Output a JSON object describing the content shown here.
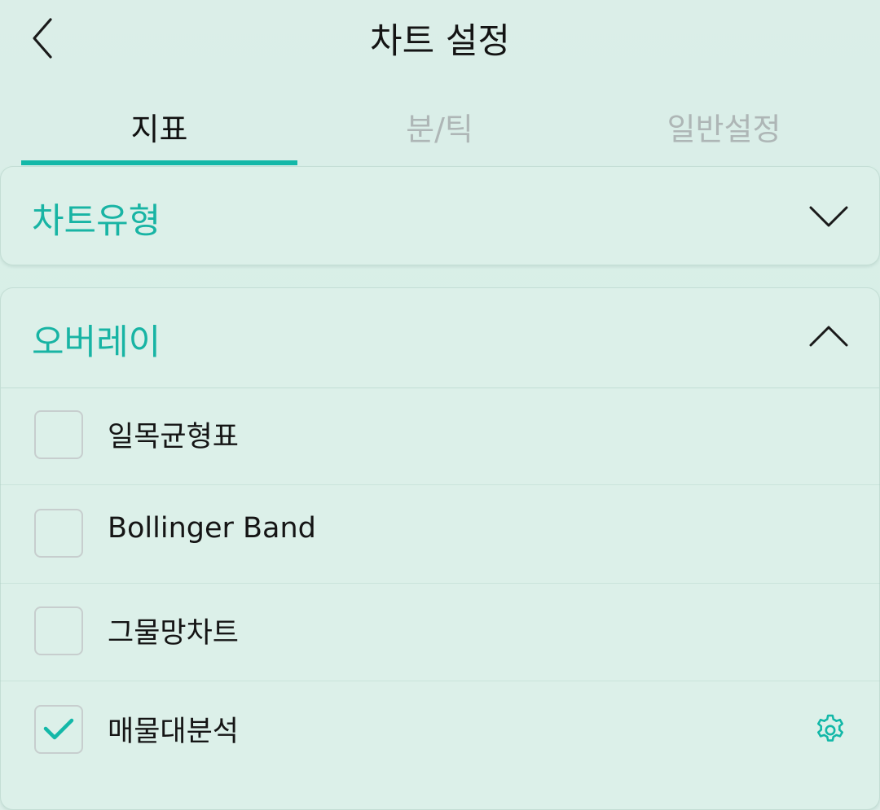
{
  "header": {
    "title": "차트 설정",
    "back_icon": "chevron-left-icon"
  },
  "tabs": [
    {
      "label": "지표",
      "active": true
    },
    {
      "label": "분/틱",
      "active": false
    },
    {
      "label": "일반설정",
      "active": false
    }
  ],
  "sections": {
    "chart_type": {
      "title": "차트유형",
      "expanded": false,
      "icon": "chevron-down-icon"
    },
    "overlay": {
      "title": "오버레이",
      "expanded": true,
      "icon": "chevron-up-icon"
    }
  },
  "overlay_items": [
    {
      "label": "일목균형표",
      "checked": false
    },
    {
      "label": "Bollinger Band",
      "checked": false
    },
    {
      "label": "그물망차트",
      "checked": false
    },
    {
      "label": "매물대분석",
      "checked": true,
      "settings_icon": "gear-icon"
    }
  ],
  "colors": {
    "accent": "#13b8a8",
    "background": "#d8efe7",
    "inactive_tab": "#aeb6b6"
  }
}
